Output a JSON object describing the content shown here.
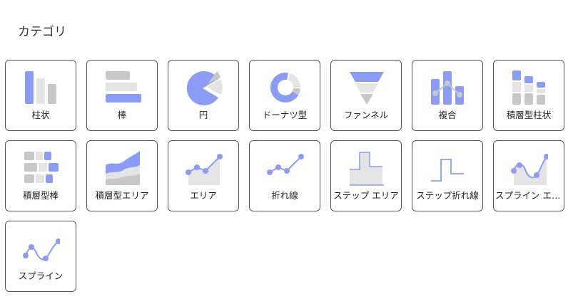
{
  "section": {
    "title": "カテゴリ"
  },
  "colors": {
    "accent": "#8b9cf7",
    "light_gray": "#e4e4e4",
    "mid_gray": "#c8c8c8"
  },
  "categories": [
    {
      "label": "柱状",
      "icon": "column-chart-icon"
    },
    {
      "label": "棒",
      "icon": "bar-chart-icon"
    },
    {
      "label": "円",
      "icon": "pie-chart-icon"
    },
    {
      "label": "ドーナツ型",
      "icon": "donut-chart-icon"
    },
    {
      "label": "ファンネル",
      "icon": "funnel-chart-icon"
    },
    {
      "label": "複合",
      "icon": "combo-chart-icon"
    },
    {
      "label": "積層型柱状",
      "icon": "stacked-column-chart-icon"
    },
    {
      "label": "積層型棒",
      "icon": "stacked-bar-chart-icon"
    },
    {
      "label": "積層型エリア",
      "icon": "stacked-area-chart-icon"
    },
    {
      "label": "エリア",
      "icon": "area-chart-icon"
    },
    {
      "label": "折れ線",
      "icon": "line-chart-icon"
    },
    {
      "label": "ステップ エリア",
      "icon": "step-area-chart-icon"
    },
    {
      "label": "ステップ折れ線",
      "icon": "step-line-chart-icon"
    },
    {
      "label": "スプライン エリア",
      "icon": "spline-area-chart-icon"
    },
    {
      "label": "スプライン",
      "icon": "spline-chart-icon"
    }
  ]
}
